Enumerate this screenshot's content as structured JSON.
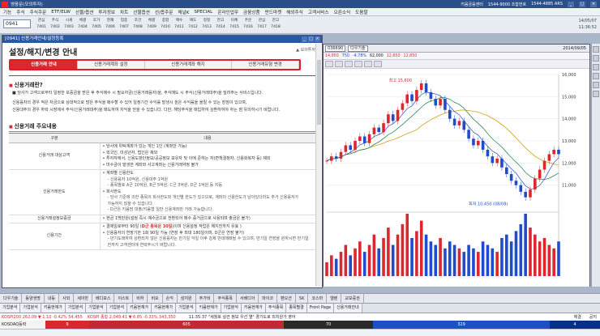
{
  "titlebar": {
    "title": "영웅문(모의투자)",
    "phones": [
      "키움금융센터",
      "1544-9000 조합번호",
      "1544-4885 ARS",
      "1544-9000"
    ]
  },
  "menubar": {
    "items": [
      "기능",
      "주식",
      "주식주문",
      "ETF/ELW",
      "선물/옵션",
      "투자정보",
      "차트",
      "선물옵션",
      "선/옵주문",
      "채널K",
      "SPECIAL",
      "온라인업무",
      "금융상품",
      "펀드마켓",
      "해외주식",
      "고객서비스",
      "오픈소식",
      "도움말"
    ]
  },
  "toolbar": {
    "combo": "0941",
    "row1": [
      "관심",
      "주식",
      "시세",
      "체결",
      "호가",
      "현재",
      "업종",
      "조건",
      "체결",
      "종합",
      "매수",
      "매도",
      "정정",
      "잔고",
      "미체",
      "주문",
      "관심",
      "잔고"
    ],
    "row2": [
      "7401",
      "7402",
      "7403",
      "7404",
      "7405",
      "7406",
      "7407",
      "7408",
      "7409",
      "7410",
      "7411",
      "7412",
      "7413",
      "7414",
      "7415",
      "7416",
      "7417",
      "7418"
    ],
    "clock_date": "14/05/07",
    "clock_time": "11:36:52"
  },
  "settings_window": {
    "title": "[0941] 신용거래안내/설정등록",
    "heading": "설정/해지/변경 안내",
    "top_link": "▲ 모의투자",
    "tabs": [
      {
        "label": "신용거래 안내",
        "active": true
      },
      {
        "label": "신용거래계좌 설정",
        "active": false
      },
      {
        "label": "신용거래계좌 해지",
        "active": false
      },
      {
        "label": "신용거래유형 변경",
        "active": false
      }
    ],
    "section1_title": "신용거래란?",
    "section1_p1": "■ 당사가 고객으로부터 일정한 보증금을 받은 후 주식매수 시 필요자금(신용거래융자)을, 주식매도 시 주식(신용거래대주)을 빌려주는 서비스입니다.",
    "section1_p2": "신용융자의 경우 적은 자금으로 상대적으로 많은 주식을 매수할 수 있어 일정기간 수익률 발생시 높은 수익률을 올릴 수 있는 장점이 있으며,",
    "section1_p3": "신용대주의 경우 하락 시장에서 주식(신용거래대주)을 매도하여 차익을 얻을 수 있습니다. 다만, 해당주식을 매입하여 상환하여야 하는 점 유의하시기 바랍니다.",
    "section2_title": "신용거래 주요내용",
    "table": {
      "headers": [
        "구분",
        "내용"
      ],
      "rows": [
        {
          "label": "신용거래 대상고객",
          "lines": [
            {
              "t": "당사에 위탁계좌가 있는 개인 1인 (계좌만 가능)",
              "sub": false
            },
            {
              "t": "외국인, 미성년자, 법인은 제외",
              "sub": false
            },
            {
              "t": "투자자에서, 신용도판단정보/공공정보 보유자 및 이에 준하는 자(면책결정자, 신용회복자 등) 제외",
              "sub": false
            },
            {
              "t": "미수금이 발생한 계좌와 사고계좌는 신용거래약정 불가",
              "sub": false
            }
          ]
        },
        {
          "label": "신용거래한도",
          "lines": [
            {
              "t": "계좌별 신용한도",
              "sub": false
            },
            {
              "t": "- 신용융자 10억원, 신용대주 1억원",
              "sub": true
            },
            {
              "t": "- 종목별로 A군 10억원, B군 5억원, C군 3억원, D군 1억원 등 차등",
              "sub": true
            },
            {
              "t": "회사한도",
              "sub": false
            },
            {
              "t": "- 당사 기준에 의한 종목의 회사한도와 개인별 한도가 있으므로, 계좌의 신용한도가 남아있더라도 추가 신용융자가",
              "sub": true
            },
            {
              "t": "  가능하지 않을 수 있습니다.",
              "sub": true
            },
            {
              "t": "- D군은 키움맘 대출/키움형 일반 신용계좌만 거래 가능합니다.",
              "sub": true
            }
          ]
        },
        {
          "label": "신용거래설정보증금",
          "lines": [
            {
              "t": "현금 1백만원(설정 즉시 예수금으로 전환되어 매수 증거금으로 사용되며 출금은 불가)",
              "sub": false
            }
          ]
        },
        {
          "label": "신용기간",
          "lines": [
            {
              "t": "결제일로부터 90일 (D군 종목은 30일)이며 신용설정 작업은 해지전까지 유효 )",
              "sub": false,
              "red": "D군 종목은 30일"
            },
            {
              "t": "신용융자의 연장기한 1회 90일 가능 (연장 후 최대 180일이며, D군은 연장 불가)",
              "sub": false
            },
            {
              "t": "- 만기도래하여 상환되지 않은 신용융자는 만기일 익일 이후 강제 반대매매될 수 있으며, 만기일 연장을 원하시면 만기일 전까지 고객센터에 연락주시기 바랍니다.",
              "sub": true
            }
          ]
        }
      ]
    }
  },
  "chart_window": {
    "stock": "다우기술",
    "quote": {
      "price": "14,950",
      "change": "750",
      "rate": "-4.78%",
      "vol": "62,000",
      "p2": "12,650",
      "p3": "12,850"
    },
    "date": "2014/09/05",
    "high_label": "최고 15,600",
    "low_label": "최저 10,450 (08/08)"
  },
  "chart_data": {
    "type": "line",
    "title": "다우기술",
    "xlabel": "",
    "ylabel": "",
    "ylim": [
      10000,
      16000
    ],
    "y_ticks": [
      16000,
      15000,
      14000,
      13000,
      12000,
      11000
    ],
    "y_tick_labels": [
      "16,000",
      "15,000",
      "14,000",
      "13,000",
      "12,000",
      "11,000"
    ],
    "x": [
      0,
      1,
      2,
      3,
      4,
      5,
      6,
      7,
      8,
      9,
      10,
      11,
      12,
      13,
      14,
      15,
      16,
      17,
      18,
      19,
      20,
      21,
      22,
      23,
      24,
      25,
      26,
      27,
      28,
      29,
      30,
      31,
      32,
      33,
      34,
      35,
      36,
      37,
      38,
      39,
      40,
      41,
      42,
      43,
      44,
      45,
      46,
      47,
      48,
      49
    ],
    "series": [
      {
        "values": [
          12100,
          12300,
          12200,
          12500,
          12800,
          12600,
          13000,
          13200,
          12900,
          13300,
          13600,
          13400,
          13800,
          14200,
          13900,
          14400,
          14700,
          15100,
          14800,
          15300,
          15600,
          15200,
          14900,
          14600,
          14900,
          14400,
          14000,
          13700,
          13900,
          13500,
          13100,
          12800,
          13000,
          12600,
          12300,
          12000,
          12200,
          11800,
          11500,
          11200,
          11000,
          10700,
          10450,
          10800,
          11300,
          11700,
          12100,
          12400,
          12600,
          12400
        ]
      }
    ],
    "volume": [
      4,
      6,
      5,
      7,
      9,
      6,
      8,
      10,
      7,
      9,
      12,
      8,
      11,
      14,
      9,
      12,
      15,
      18,
      11,
      13,
      16,
      12,
      10,
      9,
      11,
      8,
      10,
      9,
      8,
      7,
      9,
      8,
      7,
      10,
      9,
      8,
      7,
      11,
      12,
      10,
      13,
      15,
      18,
      14,
      12,
      10,
      11,
      9,
      8,
      10
    ]
  },
  "task_tabs": [
    "다우기술",
    "동양생명",
    "내등",
    "사외",
    "세이반",
    "베디포스",
    "이스트",
    "비하",
    "비요",
    "손익",
    "삼지원",
    "주가비",
    "주식종목",
    "서베디아",
    "마이코",
    "팬오션",
    "SK",
    "코스마",
    "엘렌",
    "교보증권"
  ],
  "window_tabs": [
    "기업분석",
    "기업분석",
    "키움현재가",
    "기업분석",
    "기업분석",
    "기업분석",
    "키움현재가",
    "키움현재가",
    "기업분석",
    "키움현재가",
    "기업분석",
    "키움현재가",
    "주식종목",
    "종목별결",
    "Front Page",
    "신용거래안내"
  ],
  "ticker": {
    "kospi": "KOSPI200 262.09 ▼ 1.10 -0.42% 54,455",
    "kospi2": "KOSPI 종합 2,049.41 ▼ 6.85 -0.33% 343,350",
    "news": "11:35:37 \"세월호 실건 정보 우선 열\" 경기도로 외치원가 영어",
    "btn1": "체결",
    "btn2": "공지"
  },
  "breadth": {
    "label": "KOSDAQ등락",
    "segs": [
      {
        "t": "9",
        "c": "#d9292f"
      },
      {
        "t": "605",
        "c": "#c12a33"
      },
      {
        "t": "70",
        "c": "#2a2a2a"
      },
      {
        "t": "329",
        "c": "#1d4fc5"
      },
      {
        "t": "4",
        "c": "#0a2f8a"
      }
    ]
  }
}
